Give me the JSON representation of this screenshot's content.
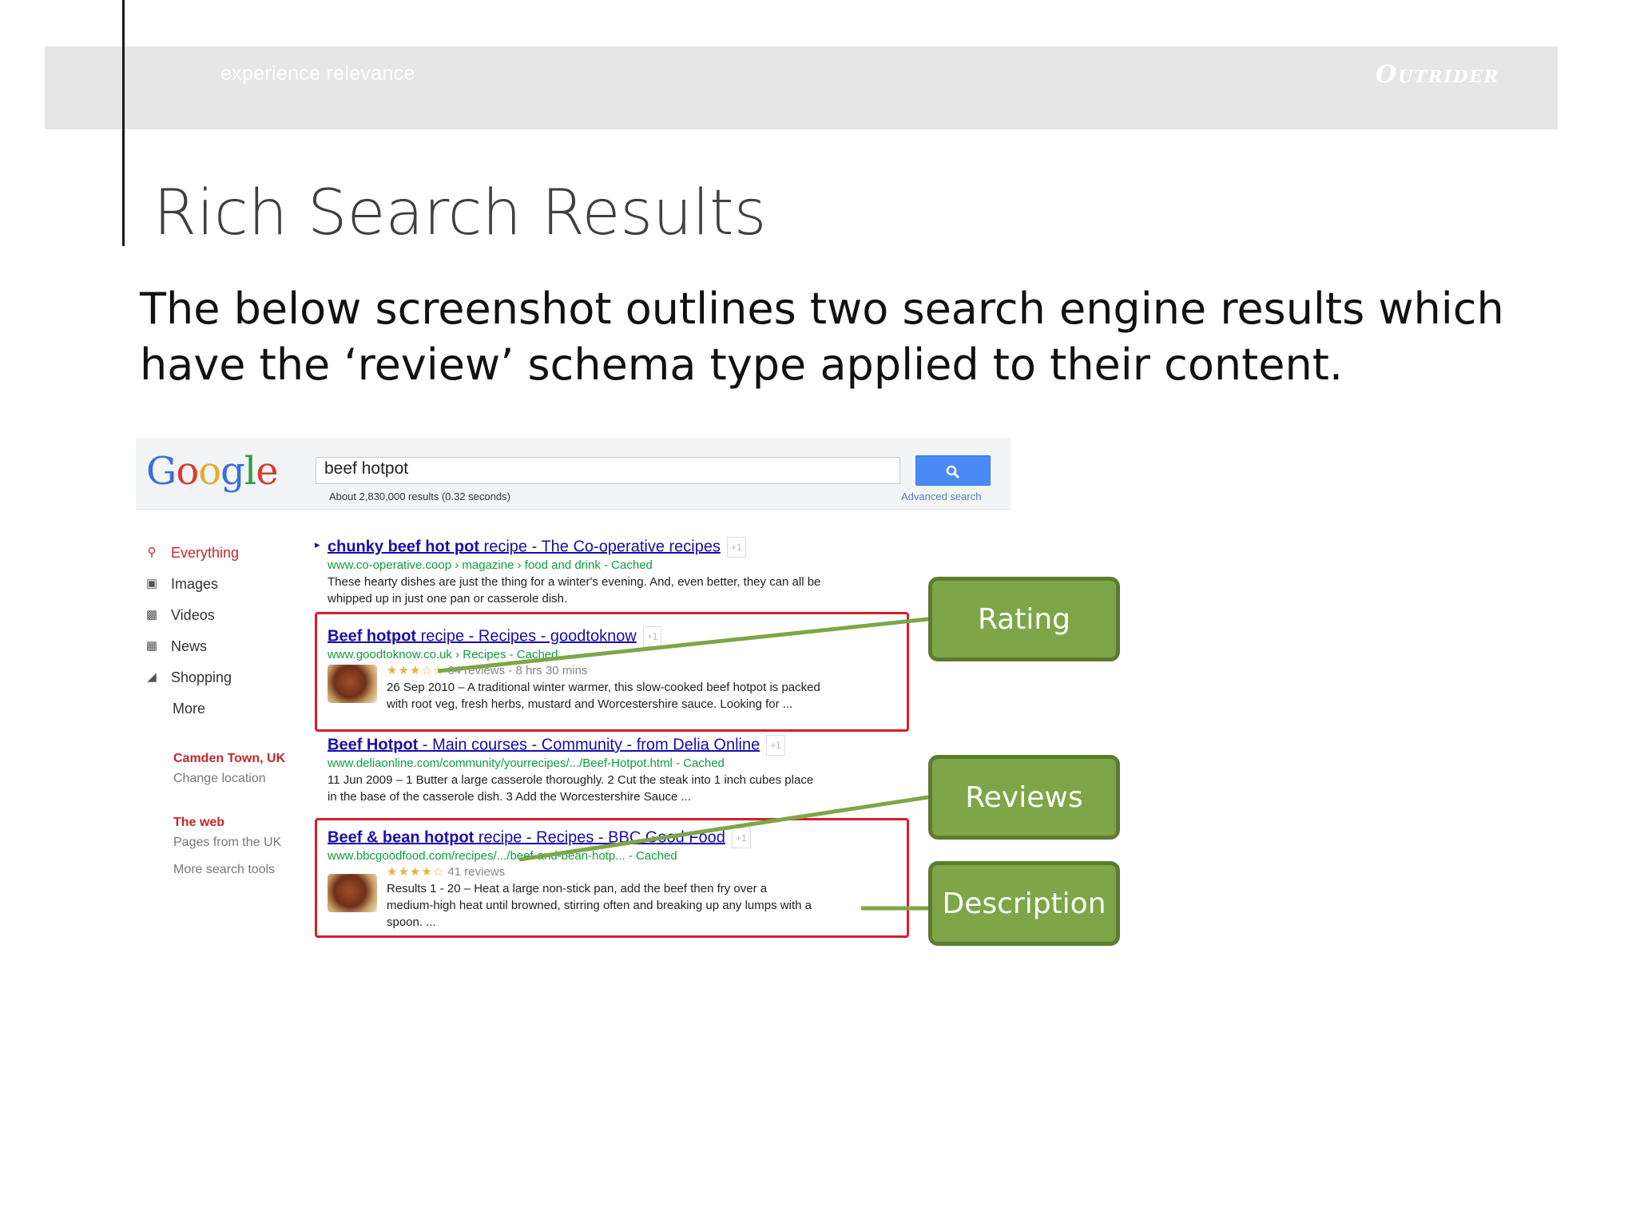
{
  "header": {
    "tagline": "experience relevance",
    "logo_text": "Outrider"
  },
  "slide": {
    "title": "Rich Search Results",
    "body_lines": [
      "The below screenshot outlines two search engine results which",
      "have the ‘review’ schema type applied to their content."
    ]
  },
  "google": {
    "logo_letters": [
      "G",
      "o",
      "o",
      "g",
      "l",
      "e"
    ],
    "logo_colors": [
      "#3b6fd9",
      "#d83b2c",
      "#e8a92b",
      "#3b6fd9",
      "#2f9b45",
      "#d83b2c"
    ],
    "query": "beef hotpot",
    "result_stats": "About 2,830,000 results (0.32 seconds)",
    "advanced_search": "Advanced search",
    "sidebar": {
      "items": [
        {
          "label": "Everything",
          "icon": "search-icon"
        },
        {
          "label": "Images",
          "icon": "camera-icon"
        },
        {
          "label": "Videos",
          "icon": "film-icon"
        },
        {
          "label": "News",
          "icon": "newspaper-icon"
        },
        {
          "label": "Shopping",
          "icon": "tag-icon"
        },
        {
          "label": "More",
          "icon": ""
        }
      ],
      "location": "Camden Town, UK",
      "change_location": "Change location",
      "the_web": "The web",
      "pages_from_uk": "Pages from the UK",
      "more_tools": "More search tools"
    },
    "results": [
      {
        "title_bold": "chunky beef hot pot",
        "title_rest": " recipe - The Co-operative recipes",
        "url": "www.co-operative.coop › magazine › food and drink - Cached",
        "snippet_1": "These hearty dishes are just the thing for a winter's evening. And, even better, they can all be",
        "snippet_2": "whipped up in just one pan or casserole dish."
      },
      {
        "title_bold": "Beef hotpot",
        "title_rest": " recipe - Recipes - goodtoknow",
        "url": "www.goodtoknow.co.uk › Recipes - Cached",
        "stars": "★★★☆☆",
        "meta": "64 reviews - 8 hrs 30 mins",
        "snippet_1": "26 Sep 2010 – A traditional winter warmer, this slow-cooked beef hotpot is packed",
        "snippet_2": "with root veg, fresh herbs, mustard and Worcestershire sauce. Looking for ..."
      },
      {
        "title_bold": "Beef Hotpot",
        "title_rest": " - Main courses - Community - from Delia Online",
        "url": "www.deliaonline.com/community/yourrecipes/.../Beef-Hotpot.html - Cached",
        "snippet_1": "11 Jun 2009 – 1 Butter a large casserole thoroughly. 2 Cut the steak into 1 inch cubes place",
        "snippet_2": "in the base of the casserole dish. 3 Add the Worcestershire Sauce ..."
      },
      {
        "title_bold": "Beef & bean hotpot",
        "title_rest": " recipe - Recipes - BBC Good Food",
        "url": "www.bbcgoodfood.com/recipes/.../beef-and-bean-hotp... - Cached",
        "stars": "★★★★☆",
        "meta": "41 reviews",
        "snippet_1": "Results 1 - 20 – Heat a large non-stick pan, add the beef then fry over a",
        "snippet_2": "medium-high heat until browned, stirring often and breaking up any lumps with a",
        "snippet_3": "spoon. ..."
      }
    ]
  },
  "callouts": {
    "rating": "Rating",
    "reviews": "Reviews",
    "description": "Description"
  },
  "colors": {
    "callout_fill": "#7ea648",
    "callout_border": "#5c7d2f",
    "highlight": "#d71e2b",
    "link": "#1a0dab",
    "url": "#0e9d3b"
  }
}
